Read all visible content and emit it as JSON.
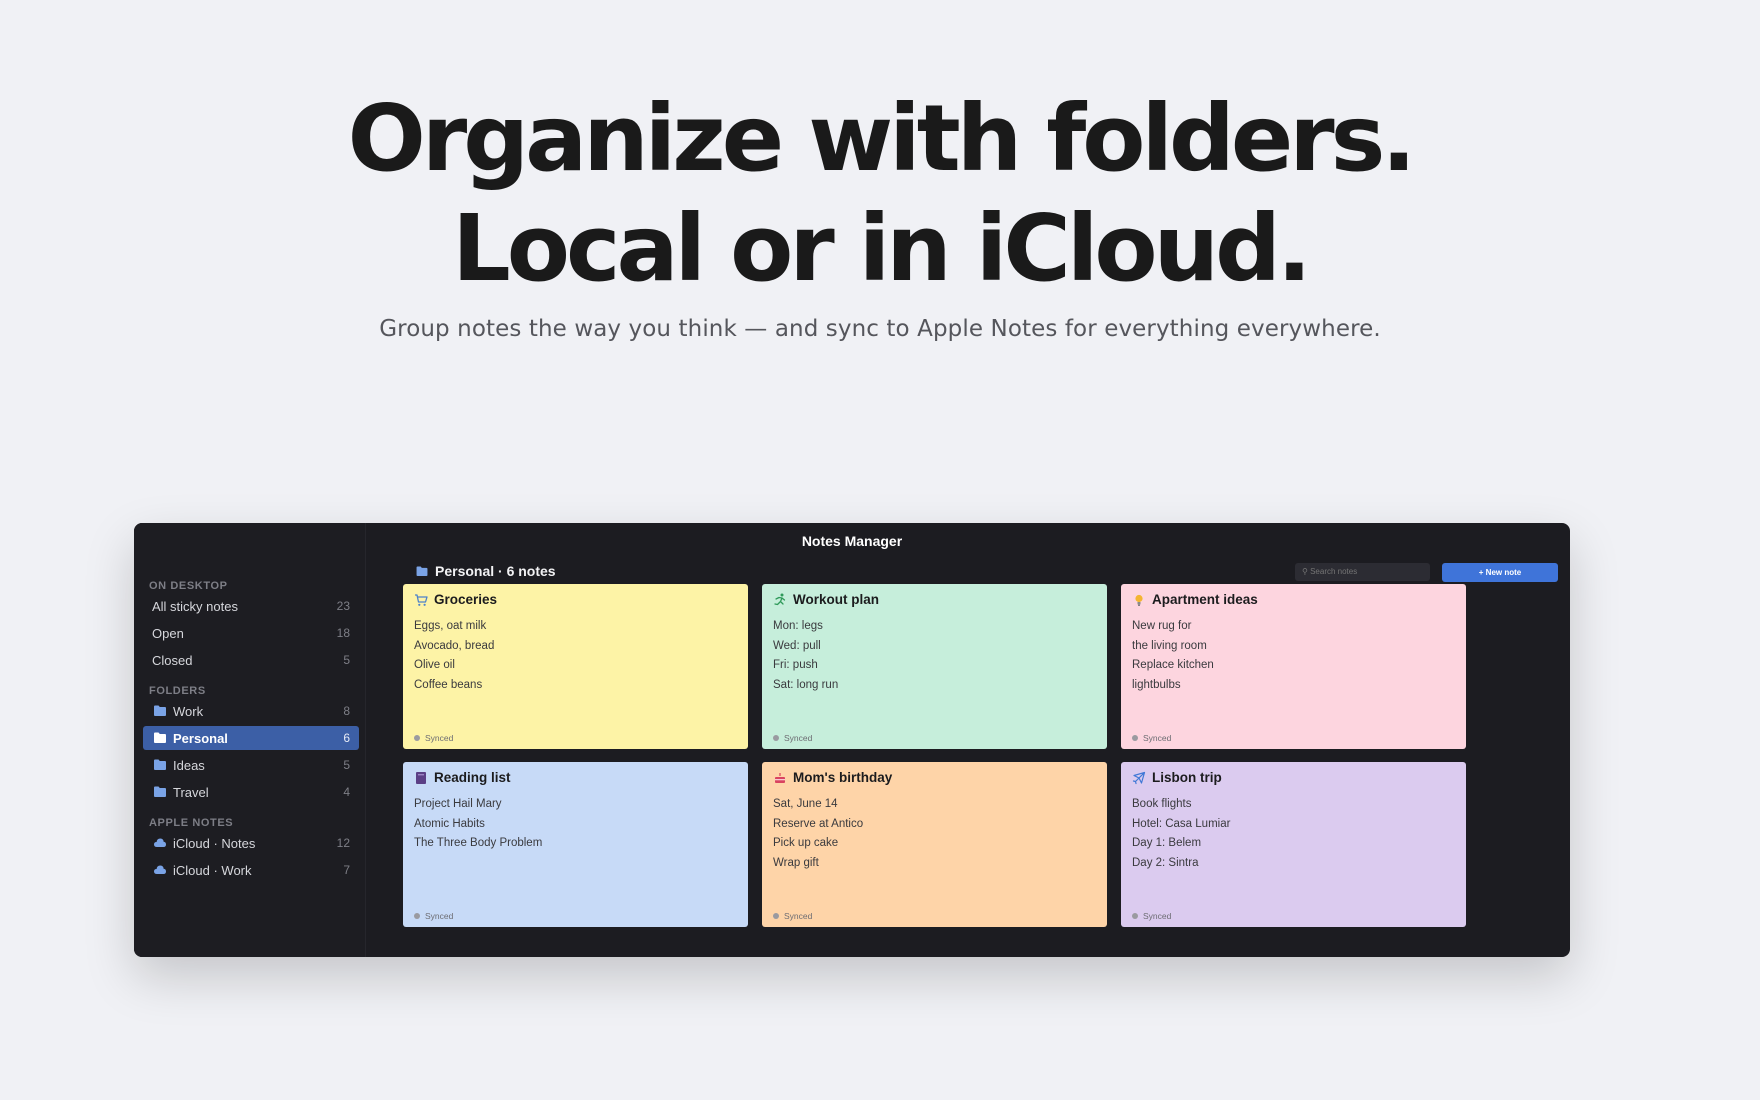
{
  "hero": {
    "line1": "Organize with folders.",
    "line2": "Local or in iCloud.",
    "subtitle": "Group notes the way you think — and sync to Apple Notes for everything everywhere."
  },
  "window": {
    "title": "Notes Manager"
  },
  "sidebar": {
    "sections": {
      "desktop": "ON DESKTOP",
      "folders": "FOLDERS",
      "apple": "APPLE NOTES"
    },
    "desktop_items": [
      {
        "label": "All sticky notes",
        "count": "23"
      },
      {
        "label": "Open",
        "count": "18"
      },
      {
        "label": "Closed",
        "count": "5"
      }
    ],
    "folder_items": [
      {
        "label": "Work",
        "count": "8",
        "icon": "folder-icon"
      },
      {
        "label": "Personal",
        "count": "6",
        "icon": "folder-icon",
        "active": true
      },
      {
        "label": "Ideas",
        "count": "5",
        "icon": "folder-icon"
      },
      {
        "label": "Travel",
        "count": "4",
        "icon": "folder-icon"
      }
    ],
    "apple_items": [
      {
        "label": "iCloud · Notes",
        "count": "12",
        "icon": "cloud-icon"
      },
      {
        "label": "iCloud · Work",
        "count": "7",
        "icon": "cloud-icon"
      }
    ]
  },
  "main": {
    "heading": "Personal · 6 notes",
    "search_placeholder": "⚲ Search notes",
    "new_note_label": "+ New note"
  },
  "notes": [
    {
      "title": "Groceries",
      "icon": "cart-icon",
      "color": "#fdf3a6",
      "lines": [
        "Eggs, oat milk",
        "Avocado, bread",
        "Olive oil",
        "Coffee beans"
      ],
      "status": "Synced"
    },
    {
      "title": "Workout plan",
      "icon": "runner-icon",
      "color": "#c6eedb",
      "lines": [
        "Mon: legs",
        "Wed: pull",
        "Fri: push",
        "Sat: long run"
      ],
      "status": "Synced"
    },
    {
      "title": "Apartment ideas",
      "icon": "lightbulb-icon",
      "color": "#fdd5df",
      "lines": [
        "New rug for",
        "the living room",
        "Replace kitchen",
        "lightbulbs"
      ],
      "status": "Synced"
    },
    {
      "title": "Reading list",
      "icon": "book-icon",
      "color": "#c7daf7",
      "lines": [
        "Project Hail Mary",
        "Atomic Habits",
        "The Three Body Problem"
      ],
      "status": "Synced"
    },
    {
      "title": "Mom's birthday",
      "icon": "cake-icon",
      "color": "#fed4a8",
      "lines": [
        "Sat, June 14",
        "Reserve at Antico",
        "Pick up cake",
        "Wrap gift"
      ],
      "status": "Synced"
    },
    {
      "title": "Lisbon trip",
      "icon": "airplane-icon",
      "color": "#dbcbef",
      "lines": [
        "Book flights",
        "Hotel: Casa Lumiar",
        "Day 1: Belem",
        "Day 2: Sintra"
      ],
      "status": "Synced"
    }
  ]
}
